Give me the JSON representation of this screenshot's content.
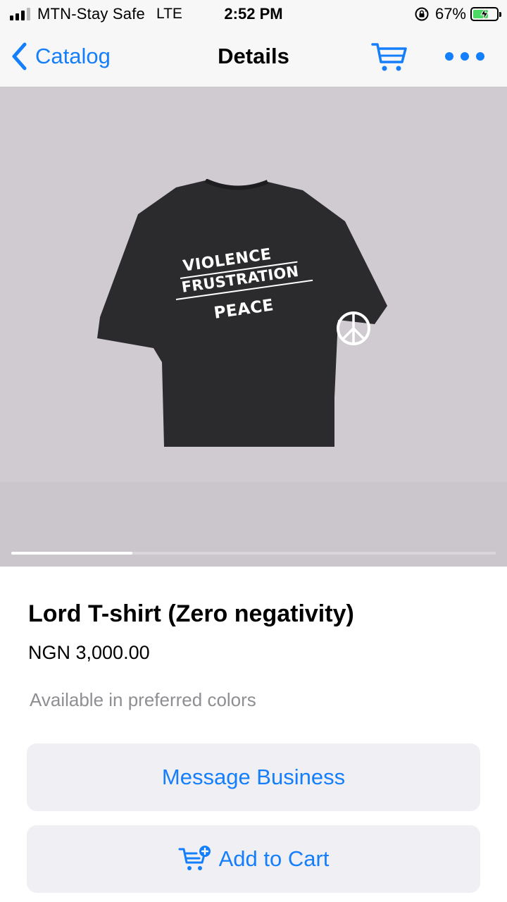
{
  "status_bar": {
    "carrier": "MTN-Stay Safe",
    "network": "LTE",
    "time": "2:52 PM",
    "battery_percent": "67%",
    "battery_level": 0.67,
    "signal_bars_active": 3,
    "signal_bars_total": 4
  },
  "nav": {
    "back_label": "Catalog",
    "title": "Details",
    "back_icon": "chevron-left-icon",
    "cart_icon": "cart-icon",
    "more_icon": "more-dots-icon"
  },
  "gallery": {
    "shirt_lines": [
      "VIOLENCE",
      "FRUSTRATION",
      "PEACE"
    ],
    "shirt_color": "#2b2a2c",
    "current_image_index": 1,
    "image_count": 4
  },
  "product": {
    "title": "Lord T-shirt (Zero negativity)",
    "price": "NGN 3,000.00",
    "description": "Available in preferred colors"
  },
  "actions": {
    "message_label": "Message Business",
    "add_to_cart_label": "Add to Cart",
    "add_to_cart_icon": "cart-plus-icon"
  },
  "colors": {
    "accent": "#157efb",
    "button_bg": "#f0f0f4",
    "secondary_text": "#8e8e93",
    "image_bg": "#cfcbd0"
  }
}
